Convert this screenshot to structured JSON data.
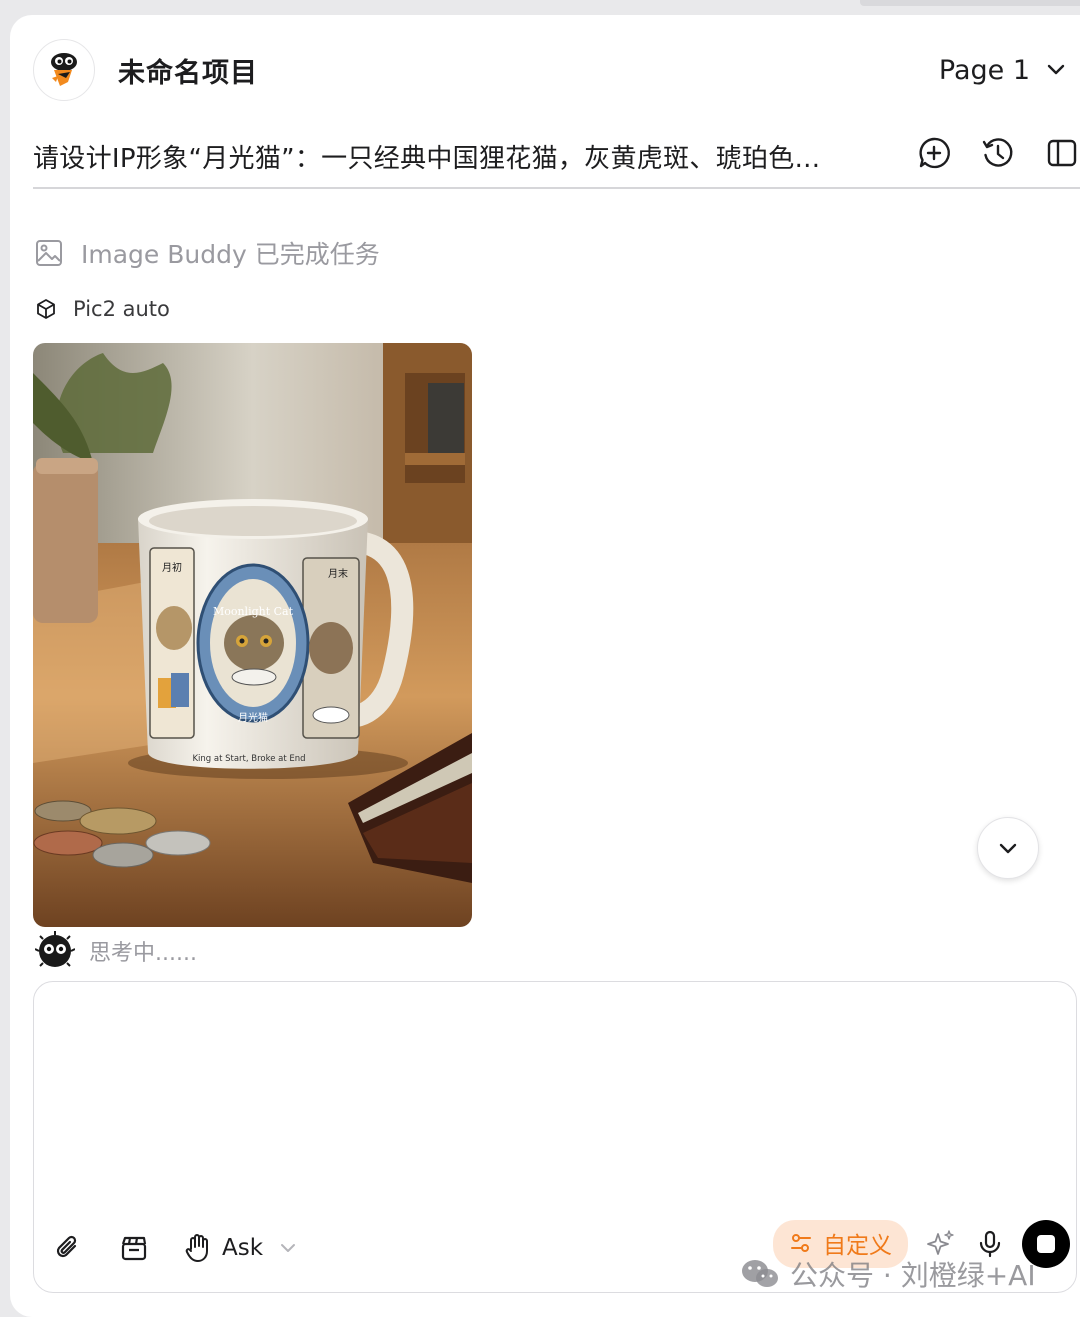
{
  "project": {
    "title": "未命名项目",
    "page_label": "Page 1"
  },
  "prompt": {
    "text": "请设计IP形象“月光猫”：一只经典中国狸花猫，灰黄虎斑、琥珀色..."
  },
  "header_icons": [
    "add-chat-icon",
    "history-icon",
    "sidebar-toggle-icon"
  ],
  "task_status": {
    "text": "Image Buddy 已完成任务"
  },
  "model": {
    "name": "Pic2 auto"
  },
  "image": {
    "mug_text": "King at Start, Broke at End",
    "badge_top": "Moonlight Cat",
    "badge_bottom": "月光猫",
    "panel_left": "月初",
    "panel_right": "月末"
  },
  "thinking": {
    "text": "思考中......"
  },
  "composer": {
    "placeholder": "",
    "mode_label": "Ask",
    "custom_label": "自定义"
  },
  "watermark": {
    "text": "公众号 · 刘橙绿+AI"
  },
  "colors": {
    "accent_orange": "#f07a1a",
    "pill_bg": "#fde5d4",
    "muted_text": "#9a9aa0"
  }
}
